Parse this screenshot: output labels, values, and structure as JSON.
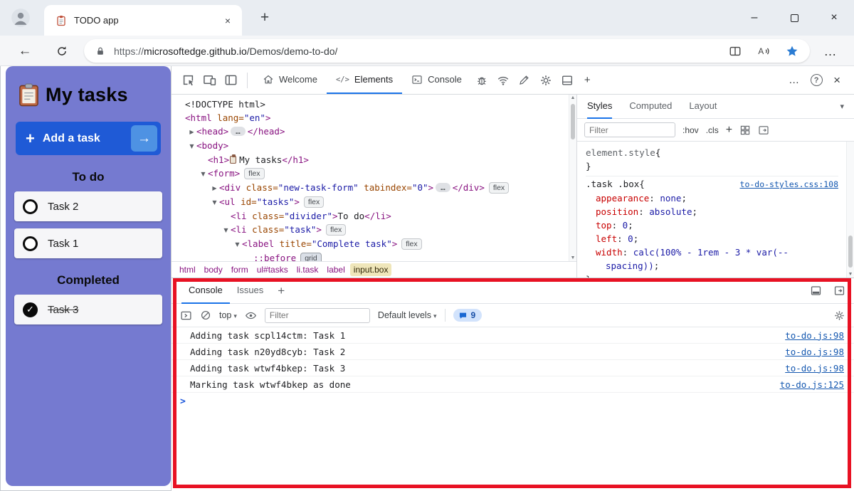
{
  "colors": {
    "todo_bg": "#757ad0",
    "add_button_blue": "#1f5ad6",
    "add_arrow_blue": "#4e92e3",
    "devtools_accent": "#1a73e8",
    "highlight_red": "#e81123",
    "link_blue": "#1558b0",
    "favorite_star_blue": "#2b7cd3",
    "badge_count_bg": "#d2e3fc"
  },
  "glyphs": {
    "minimize": "–",
    "close": "×",
    "tab_close": "×",
    "new_tab": "+",
    "back": "←",
    "menu_dots": "…",
    "more_dots": "…",
    "help": "?",
    "chevron_down": "▾",
    "plus": "+",
    "prompt": ">"
  },
  "browser": {
    "tab_title": "TODO app",
    "url_scheme": "https://",
    "url_host": "microsoftedge.github.io",
    "url_path": "/Demos/demo-to-do/"
  },
  "todo": {
    "title": "My tasks",
    "add_button": "Add a task",
    "add_plus": "+",
    "add_arrow": "→",
    "check_mark": "✓",
    "sections": [
      {
        "label": "To do",
        "tasks": [
          {
            "text": "Task 2",
            "done": false
          },
          {
            "text": "Task 1",
            "done": false
          }
        ]
      },
      {
        "label": "Completed",
        "tasks": [
          {
            "text": "Task 3",
            "done": true
          }
        ]
      }
    ]
  },
  "devtools": {
    "tabs": [
      {
        "label": "Welcome"
      },
      {
        "label": "Elements"
      },
      {
        "label": "Console"
      }
    ],
    "elements_tab_glyph": "</>",
    "dom_tree": [
      {
        "level": 0,
        "arrow": "",
        "parts": [
          [
            "plain",
            "<!DOCTYPE html>"
          ]
        ]
      },
      {
        "level": 0,
        "arrow": "",
        "parts": [
          [
            "tag",
            "<html"
          ],
          [
            "attr",
            " lang"
          ],
          [
            "punct",
            "="
          ],
          [
            "val",
            "\"en\""
          ],
          [
            "tag",
            ">"
          ]
        ]
      },
      {
        "level": 1,
        "arrow": "right",
        "parts": [
          [
            "tag",
            "<head>"
          ],
          [
            "more",
            "…"
          ],
          [
            "tag",
            "</head>"
          ]
        ]
      },
      {
        "level": 1,
        "arrow": "down",
        "parts": [
          [
            "tag",
            "<body>"
          ]
        ]
      },
      {
        "level": 2,
        "arrow": "",
        "parts": [
          [
            "tag",
            "<h1>"
          ],
          [
            "icon",
            "clipboard"
          ],
          [
            "text",
            "My tasks"
          ],
          [
            "tag",
            "</h1>"
          ]
        ]
      },
      {
        "level": 2,
        "arrow": "down",
        "parts": [
          [
            "tag",
            "<form>"
          ],
          [
            "badge",
            "flex"
          ]
        ]
      },
      {
        "level": 3,
        "arrow": "right",
        "parts": [
          [
            "tag",
            "<div"
          ],
          [
            "attr",
            " class"
          ],
          [
            "punct",
            "="
          ],
          [
            "val",
            "\"new-task-form\""
          ],
          [
            "attr",
            " tabindex"
          ],
          [
            "punct",
            "="
          ],
          [
            "val",
            "\"0\""
          ],
          [
            "tag",
            ">"
          ],
          [
            "more",
            "…"
          ],
          [
            "tag",
            "</div>"
          ],
          [
            "badge",
            "flex"
          ]
        ]
      },
      {
        "level": 3,
        "arrow": "down",
        "parts": [
          [
            "tag",
            "<ul"
          ],
          [
            "attr",
            " id"
          ],
          [
            "punct",
            "="
          ],
          [
            "val",
            "\"tasks\""
          ],
          [
            "tag",
            ">"
          ],
          [
            "badge",
            "flex"
          ]
        ]
      },
      {
        "level": 4,
        "arrow": "",
        "parts": [
          [
            "tag",
            "<li"
          ],
          [
            "attr",
            " class"
          ],
          [
            "punct",
            "="
          ],
          [
            "val",
            "\"divider\""
          ],
          [
            "tag",
            ">"
          ],
          [
            "text",
            "To do"
          ],
          [
            "tag",
            "</li>"
          ]
        ]
      },
      {
        "level": 4,
        "arrow": "down",
        "parts": [
          [
            "tag",
            "<li"
          ],
          [
            "attr",
            " class"
          ],
          [
            "punct",
            "="
          ],
          [
            "val",
            "\"task\""
          ],
          [
            "tag",
            ">"
          ],
          [
            "badge",
            "flex"
          ]
        ]
      },
      {
        "level": 5,
        "arrow": "down",
        "parts": [
          [
            "tag",
            "<label"
          ],
          [
            "attr",
            " title"
          ],
          [
            "punct",
            "="
          ],
          [
            "val",
            "\"Complete task\""
          ],
          [
            "tag",
            ">"
          ],
          [
            "badge",
            "flex"
          ]
        ]
      },
      {
        "level": 6,
        "arrow": "",
        "parts": [
          [
            "pseudo",
            "::before"
          ],
          [
            "badge",
            "grid"
          ]
        ]
      }
    ],
    "breadcrumbs": [
      {
        "label": "html"
      },
      {
        "label": "body"
      },
      {
        "label": "form"
      },
      {
        "label": "ul#tasks"
      },
      {
        "label": "li.task"
      },
      {
        "label": "label"
      },
      {
        "label": "input.box",
        "selected": true
      }
    ],
    "styles_pane": {
      "tabs": [
        "Styles",
        "Computed",
        "Layout"
      ],
      "filter_placeholder": "Filter",
      "pseudo_button": ":hov",
      "class_button": ".cls",
      "rules": [
        {
          "selector": "element.style",
          "link": "",
          "props": []
        },
        {
          "selector": ".task .box",
          "link": "to-do-styles.css:108",
          "props": [
            {
              "name": "appearance",
              "value": "none"
            },
            {
              "name": "position",
              "value": "absolute"
            },
            {
              "name": "top",
              "value": "0"
            },
            {
              "name": "left",
              "value": "0"
            },
            {
              "name": "width",
              "value": "calc(100% - 1rem - 3 * var(--spacing))"
            }
          ]
        }
      ]
    },
    "console": {
      "tabs": [
        "Console",
        "Issues"
      ],
      "context_selector": "top",
      "filter_placeholder": "Filter",
      "levels_label": "Default levels",
      "message_count": "9",
      "messages": [
        {
          "text": "Adding task scpl14ctm: Task 1",
          "source": "to-do.js:98"
        },
        {
          "text": "Adding task n20yd8cyb: Task 2",
          "source": "to-do.js:98"
        },
        {
          "text": "Adding task wtwf4bkep: Task 3",
          "source": "to-do.js:98"
        },
        {
          "text": "Marking task wtwf4bkep as done",
          "source": "to-do.js:125"
        }
      ]
    }
  }
}
